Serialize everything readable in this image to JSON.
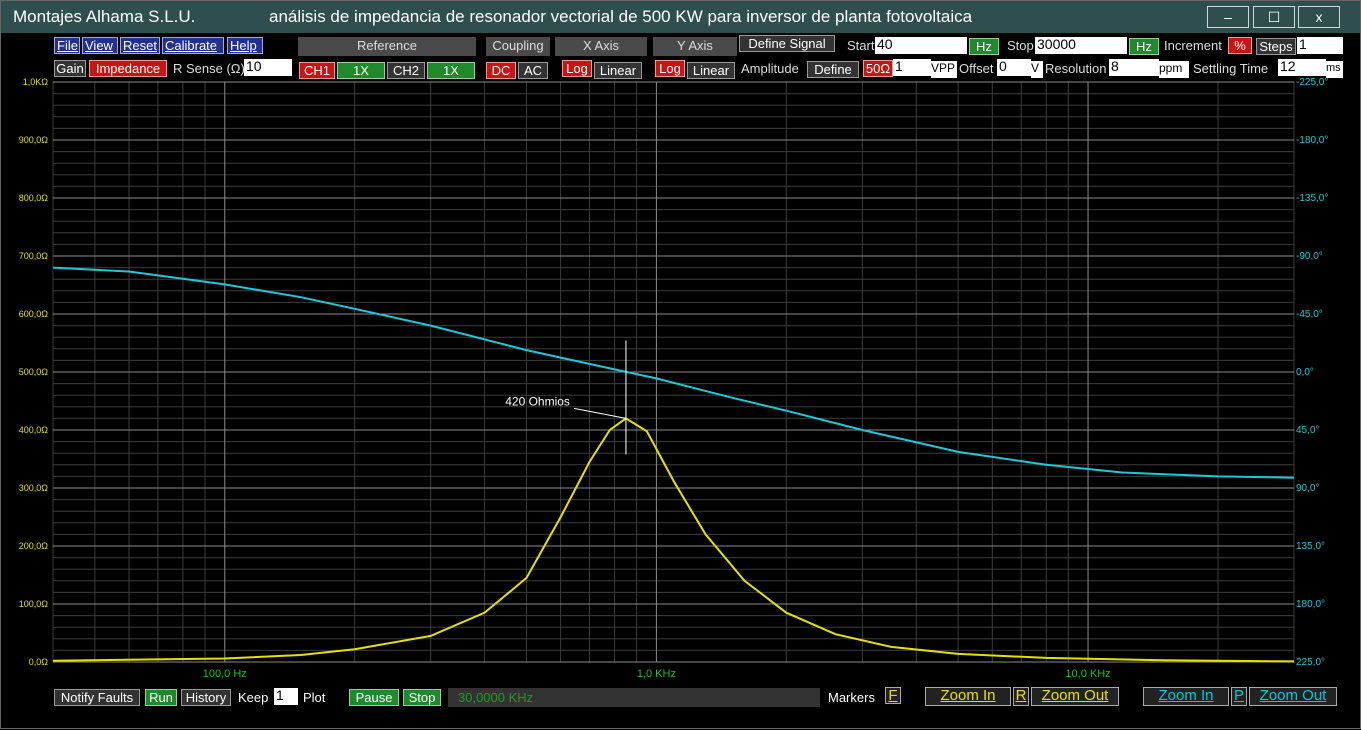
{
  "window": {
    "company": "Montajes Alhama S.L.U.",
    "title": "análisis de impedancia de resonador vectorial de 500 KW para inversor de planta fotovoltaica",
    "minimize": "–",
    "maximize": "☐",
    "close": "x"
  },
  "menu": {
    "file": "File",
    "view": "View",
    "reset": "Reset",
    "calibrate": "Calibrate",
    "help": "Help"
  },
  "toolbar": {
    "gain": "Gain",
    "impedance": "Impedance",
    "rsense_label": "R Sense (Ω)",
    "rsense_value": "10",
    "reference": "Reference",
    "coupling": "Coupling",
    "xaxis": "X Axis",
    "yaxis": "Y Axis",
    "ch1": "CH1",
    "ch1_gain": "1X",
    "ch2": "CH2",
    "ch2_gain": "1X",
    "dc": "DC",
    "ac": "AC",
    "x_log": "Log",
    "x_linear": "Linear",
    "y_log": "Log",
    "y_linear": "Linear",
    "define_signal": "Define Signal",
    "start_label": "Start",
    "start_value": "40",
    "start_unit": "Hz",
    "stop_label": "Stop",
    "stop_value": "30000",
    "stop_unit": "Hz",
    "increment_label": "Increment",
    "increment_unit": "%",
    "steps_label": "Steps",
    "steps_value": "1",
    "amplitude_label": "Amplitude",
    "define": "Define",
    "ohm50": "50Ω",
    "amp_value": "1",
    "vpp": "VPP",
    "offset_label": "Offset",
    "offset_value": "0",
    "offset_unit": "V",
    "resolution_label": "Resolution",
    "resolution_value": "8",
    "resolution_unit": "ppm",
    "settling_label": "Settling Time",
    "settling_value": "12",
    "settling_unit": "ms"
  },
  "bottom": {
    "notify": "Notify Faults",
    "run": "Run",
    "history": "History",
    "keep_label": "Keep",
    "keep_value": "1",
    "plot": "Plot",
    "pause": "Pause",
    "stop": "Stop",
    "status": "30,0000 KHz",
    "markers": "Markers",
    "markers_key": "F",
    "zoom_in_left": "Zoom In",
    "r_key": "R",
    "zoom_out_left": "Zoom Out",
    "zoom_in_right": "Zoom In",
    "p_key": "P",
    "zoom_out_right": "Zoom Out"
  },
  "colors": {
    "impedance": "#e6e000",
    "phase": "#1ec8d8",
    "grid_major": "#8a8a8a",
    "grid_minor": "#3c3c3c",
    "freq_labels": "#22c022"
  },
  "chart_data": {
    "type": "line",
    "x_scale": "log",
    "xlim": [
      40,
      30000
    ],
    "x_tick_labels": [
      {
        "x": 100,
        "label": "100,0 Hz"
      },
      {
        "x": 1000,
        "label": "1,0 KHz"
      },
      {
        "x": 10000,
        "label": "10,0 KHz"
      }
    ],
    "ylim_left": [
      0,
      1000
    ],
    "y_left_ticks": [
      0,
      100,
      200,
      300,
      400,
      500,
      600,
      700,
      800,
      900,
      1000
    ],
    "y_left_tick_labels": [
      "0,0Ω",
      "100,0Ω",
      "200,0Ω",
      "300,0Ω",
      "400,0Ω",
      "500,0Ω",
      "600,0Ω",
      "700,0Ω",
      "800,0Ω",
      "900,0Ω",
      "1,0KΩ"
    ],
    "ylim_right": [
      -225,
      225
    ],
    "y_right_ticks": [
      -225,
      -180,
      -135,
      -90,
      -45,
      0,
      45,
      90,
      135,
      180,
      225
    ],
    "y_right_tick_labels": [
      "225,0°",
      "180,0°",
      "135,0°",
      "90,0°",
      "45,0°",
      "0,0°",
      "-45,0°",
      "-90,0°",
      "-135,0°",
      "-180,0°",
      "-225,0°"
    ],
    "series": [
      {
        "axis": "left",
        "x": [
          40,
          100,
          150,
          200,
          300,
          400,
          500,
          600,
          700,
          780,
          850,
          950,
          1100,
          1300,
          1600,
          2000,
          2600,
          3500,
          5000,
          8000,
          15000,
          30000
        ],
        "y": [
          2,
          6,
          12,
          22,
          45,
          85,
          145,
          250,
          345,
          400,
          420,
          398,
          310,
          220,
          140,
          85,
          48,
          26,
          14,
          7,
          3,
          1
        ]
      },
      {
        "axis": "right",
        "x": [
          40,
          60,
          100,
          150,
          200,
          300,
          500,
          800,
          1000,
          1500,
          2000,
          3000,
          5000,
          8000,
          12000,
          20000,
          30000
        ],
        "y": [
          81,
          78,
          68,
          58,
          49,
          36,
          17,
          2,
          -5,
          -20,
          -30,
          -45,
          -62,
          -72,
          -78,
          -81,
          -82
        ]
      }
    ],
    "annotations": [
      {
        "text": "420 Ohmios",
        "x": 850,
        "y": 420
      }
    ]
  }
}
